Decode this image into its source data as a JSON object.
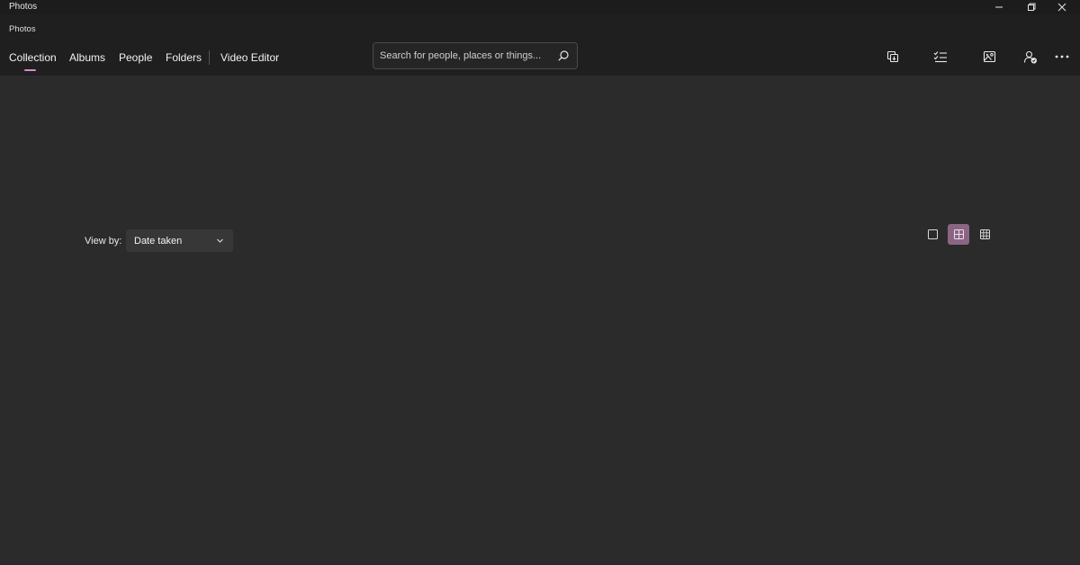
{
  "window": {
    "title": "Photos"
  },
  "app": {
    "title": "Photos"
  },
  "nav": {
    "tabs": [
      {
        "label": "Collection",
        "active": true
      },
      {
        "label": "Albums"
      },
      {
        "label": "People"
      },
      {
        "label": "Folders"
      },
      {
        "label": "Video Editor"
      }
    ]
  },
  "search": {
    "placeholder": "Search for people, places or things..."
  },
  "toolbar": {
    "icons": [
      "import-icon",
      "select-icon",
      "slideshow-icon",
      "sign-in-icon",
      "more-icon"
    ]
  },
  "view_by": {
    "label": "View by:",
    "selected": "Date taken"
  },
  "view_sizes": {
    "options": [
      "large-view-icon",
      "medium-view-icon",
      "small-view-icon"
    ],
    "active": "medium-view-icon"
  },
  "colors": {
    "accent": "#d18ccd",
    "active_view_bg": "#8a6684",
    "background": "#2b2b2b",
    "header": "#1f1f1f"
  }
}
